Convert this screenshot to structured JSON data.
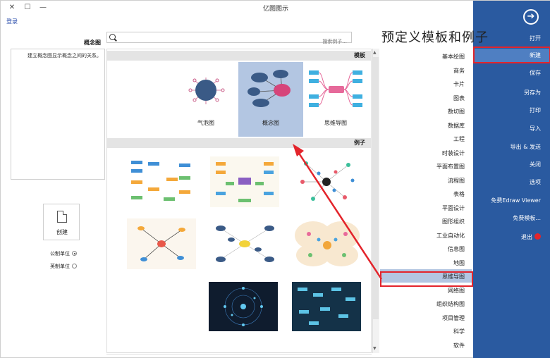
{
  "window": {
    "title": "亿图图示",
    "login": "登录"
  },
  "menu": {
    "items": [
      "打开",
      "新建",
      "保存",
      "另存为",
      "打印",
      "导入",
      "导出 & 发送",
      "关闭",
      "选项",
      "免费Edraw Viewer",
      "免费模板...",
      "退出"
    ],
    "active_index": 1
  },
  "heading": "预定义模板和例子",
  "search": {
    "placeholder": "搜索例子..."
  },
  "categories": {
    "items": [
      "基本绘图",
      "商务",
      "卡片",
      "图表",
      "数切图",
      "数据库",
      "工程",
      "时装设计",
      "平面布置图",
      "流程图",
      "表格",
      "平面设计",
      "图形组织",
      "工业自动化",
      "信息图",
      "地图",
      "思维导图",
      "网络图",
      "组织结构图",
      "项目管理",
      "科学",
      "软件"
    ],
    "selected_index": 16
  },
  "templates": {
    "header": "模板",
    "items": [
      "思维导图",
      "概念图",
      "气泡图"
    ],
    "selected_index": 1
  },
  "examples": {
    "header": "例子"
  },
  "left_panel": {
    "title": "概念图",
    "description": "建立概念图显示概念之间的关系。",
    "create_label": "创建",
    "units": [
      "公制单位",
      "英制单位"
    ],
    "selected_unit": 0
  },
  "colors": {
    "menu_bg": "#2a5aa0",
    "menu_active": "#4f7fc2",
    "highlight": "#e3242b",
    "selection": "#b3c6e2"
  }
}
